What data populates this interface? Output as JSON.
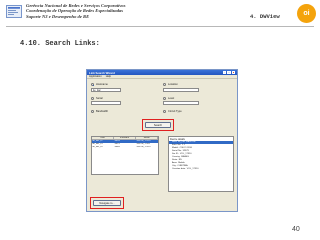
{
  "header": {
    "lines": [
      "Gerência Nacional de Redes e Serviços Corporativos",
      "Coordenação de Operação de Redes Especializadas",
      "Suporte N3 e Desempenho de RE"
    ],
    "section": "4. DWView",
    "brand": "oi"
  },
  "slide": {
    "title": "4.10. Search Links:",
    "page_number": "40"
  },
  "window": {
    "title": "Link Search Wizard",
    "menu": [
      "Application",
      "Help"
    ],
    "radio_options": [
      {
        "label": "Hostname",
        "checked": true
      },
      {
        "label": "Serial",
        "checked": false
      },
      {
        "label": "Bandwidth",
        "checked": false
      }
    ],
    "right_radio_options": [
      {
        "label": "Location",
        "checked": false
      },
      {
        "label": "Level",
        "checked": false
      },
      {
        "label": "Circuit Type",
        "checked": false
      }
    ],
    "hostname_value": "ite_riac",
    "search_button": "Search",
    "table": {
      "headers": [
        "Host",
        "Interface",
        "Serial"
      ],
      "rows": [
        [
          "ite_riac_c2",
          "Se1/0",
          "SW OB_17210"
        ],
        [
          "ite_riac_c3",
          "Se1/1",
          "SW OB_17311"
        ],
        [
          "ite_riac_c4",
          "Se0/0",
          "SW OB_17510"
        ]
      ],
      "selected_row": 0
    },
    "detail": {
      "title": "Device details",
      "rows": [
        {
          "k": "Host:",
          "v": "ite_riac WAN Link"
        },
        {
          "k": "Iface Sw:",
          "v": "1.1"
        },
        {
          "k": "Model:",
          "v": "CISCO 2610"
        },
        {
          "k": "Serial No:",
          "v": "32379"
        },
        {
          "k": "Ser ID:",
          "v": "VOL_17310"
        },
        {
          "k": "Country:",
          "v": "BRASIL"
        },
        {
          "k": "State:",
          "v": "RS"
        },
        {
          "k": "Area:",
          "v": "Mobile"
        },
        {
          "k": "City:",
          "v": "CURITIBA"
        },
        {
          "k": "Creation date:",
          "v": "VOL_17310"
        }
      ],
      "selected_row": 0
    },
    "navigate_button": "Navigate to..."
  },
  "colors": {
    "highlight": "#e02020",
    "titlebar": "#2456c0",
    "window_bg": "#ece9d8",
    "selection": "#316ac5",
    "brand_orange": "#f4a30c"
  },
  "icons": {
    "company_logo": "document-logo-icon",
    "brand_logo": "oi-logo-icon"
  }
}
